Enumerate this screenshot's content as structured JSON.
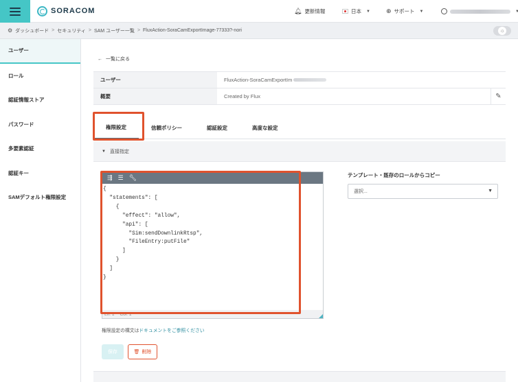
{
  "header": {
    "brand": "SORACOM",
    "nav": {
      "updates": "更新情報",
      "language": "日本",
      "support": "サポート"
    }
  },
  "breadcrumb": {
    "items": [
      "ダッシュボード",
      "セキュリティ",
      "SAM ユーザー一覧",
      "FluxAction-SoraCamExportImage-77333?-nori"
    ]
  },
  "sidebar": {
    "items": [
      {
        "label": "ユーザー"
      },
      {
        "label": "ロール"
      },
      {
        "label": "認証情報ストア"
      },
      {
        "label": "パスワード"
      },
      {
        "label": "多要素認証"
      },
      {
        "label": "認証キー"
      },
      {
        "label": "SAMデフォルト権限設定"
      }
    ]
  },
  "main": {
    "back_link": "一覧に戻る",
    "info": {
      "user_label": "ユーザー",
      "user_value": "FluxAction-SoraCamExportIm",
      "description_label": "概要",
      "description_value": "Created by Flux"
    },
    "tabs": [
      {
        "label": "権限設定"
      },
      {
        "label": "信頼ポリシー"
      },
      {
        "label": "認証設定"
      },
      {
        "label": "高度な設定"
      }
    ],
    "section_title": "直接指定",
    "editor": {
      "code": "{\n  \"statements\": [\n    {\n      \"effect\": \"allow\",\n      \"api\": [\n        \"Sim:sendDownlinkRtsp\",\n        \"FileEntry:putFile\"\n      ]\n    }\n  ]\n}",
      "status_line": "Ln: 1",
      "status_col": "Col: 1"
    },
    "doc_note_prefix": "権限設定の構文は",
    "doc_note_link": "ドキュメントをご参照ください",
    "save_label": "保存",
    "delete_label": "削除",
    "copy_label": "テンプレート・既存のロールからコピー",
    "copy_placeholder": "選択..."
  }
}
